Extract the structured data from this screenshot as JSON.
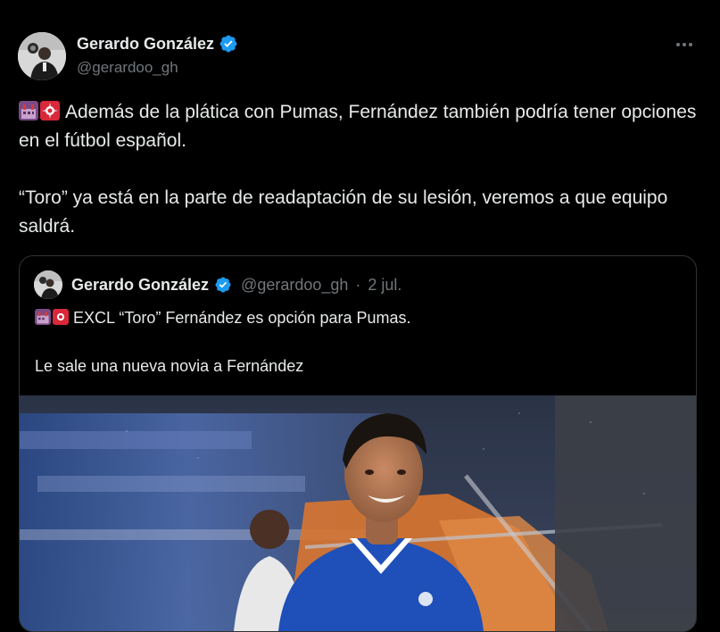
{
  "author": {
    "name": "Gerardo González",
    "handle": "@gerardoo_gh",
    "verified": true
  },
  "icons": {
    "verified": "verified-badge-icon",
    "more": "more-options-icon",
    "emoji_1": "station-emoji",
    "emoji_2": "rotating-light-emoji"
  },
  "tweet": {
    "paragraph_1": "Además de la plática con Pumas, Fernández también podría tener opciones en el fútbol español.",
    "paragraph_2": "“Toro” ya está en la parte de readaptación de su lesión, veremos a que equipo saldrá."
  },
  "quoted_tweet": {
    "name": "Gerardo González",
    "handle": "@gerardoo_gh",
    "separator": "·",
    "date": "2 jul.",
    "paragraph_1": "EXCL “Toro” Fernández es opción para Pumas.",
    "paragraph_2": "Le sale una nueva novia a Fernández"
  },
  "colors": {
    "background": "#000000",
    "text_primary": "#e7e9ea",
    "text_secondary": "#71767b",
    "border": "#2f3336",
    "verified_blue": "#1d9bf0",
    "jersey_blue": "#1f4fb8",
    "stadium_orange": "#d9752f"
  }
}
